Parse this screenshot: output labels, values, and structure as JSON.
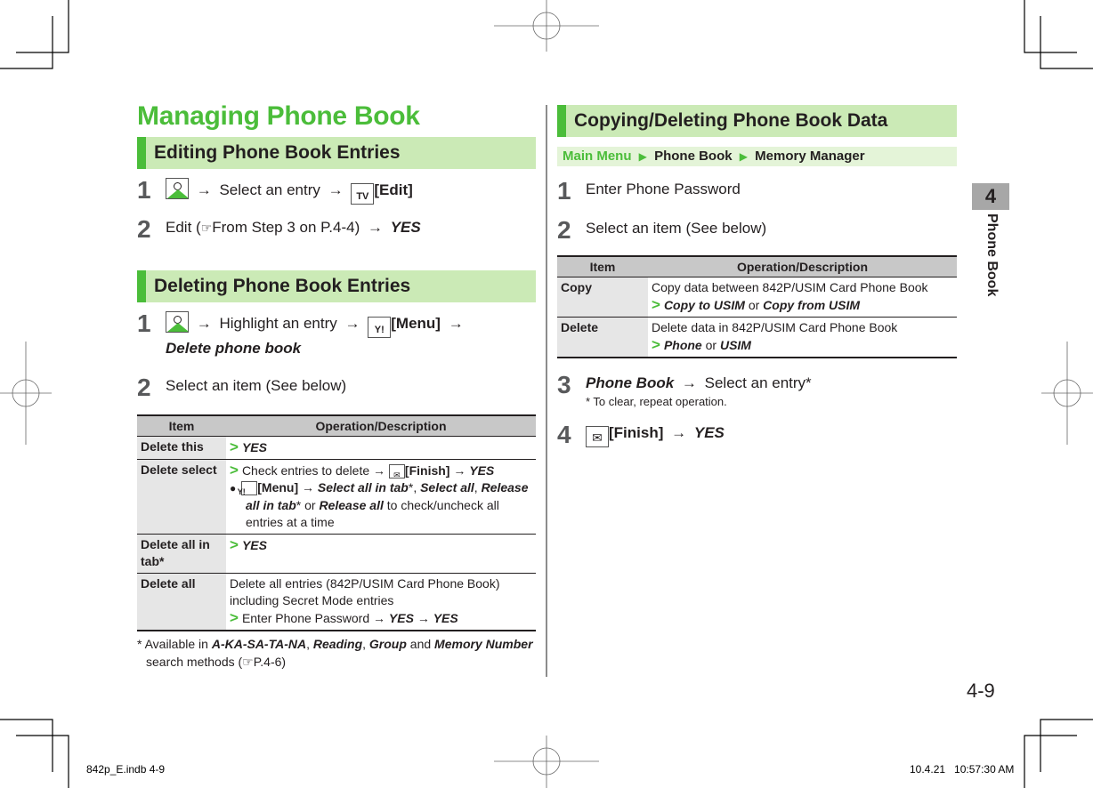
{
  "page": {
    "title": "Managing Phone Book",
    "chapter_number": "4",
    "chapter_label": "Phone Book",
    "page_number": "4-9",
    "slug_left": "842p_E.indb   4-9",
    "slug_right": "10.4.21   10:57:30 AM",
    "colors": {
      "accent_green": "#4bbd3a",
      "header_bg": "#cbeab6",
      "table_header_bg": "#c8c8c8",
      "item_bg": "#e6e6e6"
    }
  },
  "editing": {
    "heading": "Editing Phone Book Entries",
    "steps": [
      {
        "num": "1",
        "icon1": "phone-book-key-icon",
        "arrow": "→",
        "text": "Select an entry",
        "icon2": "tv-key-icon",
        "icon2_glyph": "TV",
        "key_label": "[Edit]"
      },
      {
        "num": "2",
        "text_before": "Edit (",
        "ref_icon": "☞",
        "ref_text": "From Step 3 on P.4-4)",
        "arrow": "→",
        "result": "YES"
      }
    ]
  },
  "deleting": {
    "heading": "Deleting Phone Book Entries",
    "steps": [
      {
        "num": "1",
        "icon1": "phone-book-key-icon",
        "arrow": "→",
        "text": "Highlight an entry",
        "icon2_glyph": "Y!",
        "key_label": "[Menu]",
        "result": "Delete phone book"
      },
      {
        "num": "2",
        "text": "Select an item (See below)"
      }
    ],
    "table": {
      "headers": [
        "Item",
        "Operation/Description"
      ],
      "rows": [
        {
          "item": "Delete this",
          "gt": ">",
          "op": "YES"
        },
        {
          "item": "Delete select",
          "gt": ">",
          "op_text": "Check entries to delete",
          "arrow": "→",
          "mail_glyph": "✉",
          "finish": "[Finish]",
          "op_result": "YES",
          "bullet": "●",
          "menu_glyph": "Y!",
          "menu": "[Menu]",
          "opt1": "Select all in tab",
          "star": "*",
          "comma": ",",
          "opt2": "Select all",
          "opt3": "Release all in tab",
          "or": "or",
          "opt4": "Release all",
          "tail": "to check/uncheck all entries at a time"
        },
        {
          "item": "Delete all in tab*",
          "gt": ">",
          "op": "YES"
        },
        {
          "item": "Delete all",
          "desc": "Delete all entries (842P/USIM Card Phone Book) including Secret Mode entries",
          "gt": ">",
          "op_text": "Enter Phone Password",
          "arrow": "→",
          "yes": "YES"
        }
      ]
    },
    "footnote": {
      "star": "*",
      "text1": "Available in",
      "m1": "A-KA-SA-TA-NA",
      "m2": "Reading",
      "m3": "Group",
      "and": "and",
      "m4": "Memory Number",
      "text2": "search methods (",
      "ref_icon": "☞",
      "ref": "P.4-6)"
    }
  },
  "copying": {
    "heading": "Copying/Deleting Phone Book Data",
    "breadcrumb": {
      "root": "Main Menu",
      "sep": "▶",
      "items": [
        "Phone Book",
        "Memory Manager"
      ]
    },
    "steps": [
      {
        "num": "1",
        "text": "Enter Phone Password"
      },
      {
        "num": "2",
        "text": "Select an item (See below)"
      },
      {
        "num": "3",
        "label": "Phone Book",
        "arrow": "→",
        "text": "Select an entry*",
        "note": "* To clear, repeat operation."
      },
      {
        "num": "4",
        "mail_glyph": "✉",
        "key_label": "[Finish]",
        "arrow": "→",
        "result": "YES"
      }
    ],
    "table": {
      "headers": [
        "Item",
        "Operation/Description"
      ],
      "rows": [
        {
          "item": "Copy",
          "desc": "Copy data between 842P/USIM Card Phone Book",
          "gt": ">",
          "a": "Copy to USIM",
          "or": "or",
          "b": "Copy from USIM"
        },
        {
          "item": "Delete",
          "desc": "Delete data in 842P/USIM Card Phone Book",
          "gt": ">",
          "a": "Phone",
          "or": "or",
          "b": "USIM"
        }
      ]
    }
  }
}
